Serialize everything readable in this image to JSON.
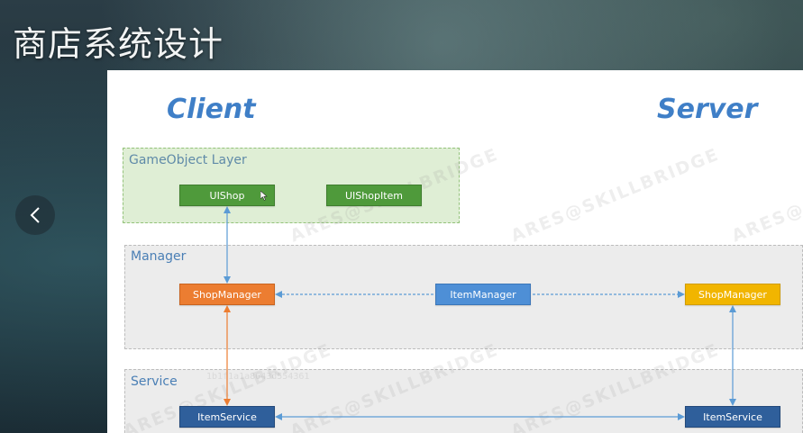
{
  "page": {
    "title": "商店系统设计"
  },
  "diagram": {
    "headers": {
      "client": "Client",
      "server": "Server"
    },
    "layers": {
      "gameobject": "GameObject Layer",
      "manager": "Manager",
      "service": "Service"
    },
    "nodes": {
      "ui_shop": "UIShop",
      "ui_shop_item": "UIShopItem",
      "shop_manager_client": "ShopManager",
      "item_manager": "ItemManager",
      "shop_manager_server": "ShopManager",
      "item_service_client": "ItemService",
      "item_service_server": "ItemService"
    },
    "colors": {
      "gameobject_node": "#4f9a3b",
      "shop_manager_client": "#ec7d31",
      "item_manager": "#4e8fd6",
      "shop_manager_server": "#f1b500",
      "item_service": "#2f5f9b",
      "arrow_blue": "#5b9bd5",
      "arrow_orange": "#ed7d31",
      "header": "#3f7fc7"
    }
  },
  "watermark": {
    "text": "ARES@SKILLBRIDGE",
    "id_text": "1b1f1a1a8643d554361"
  }
}
